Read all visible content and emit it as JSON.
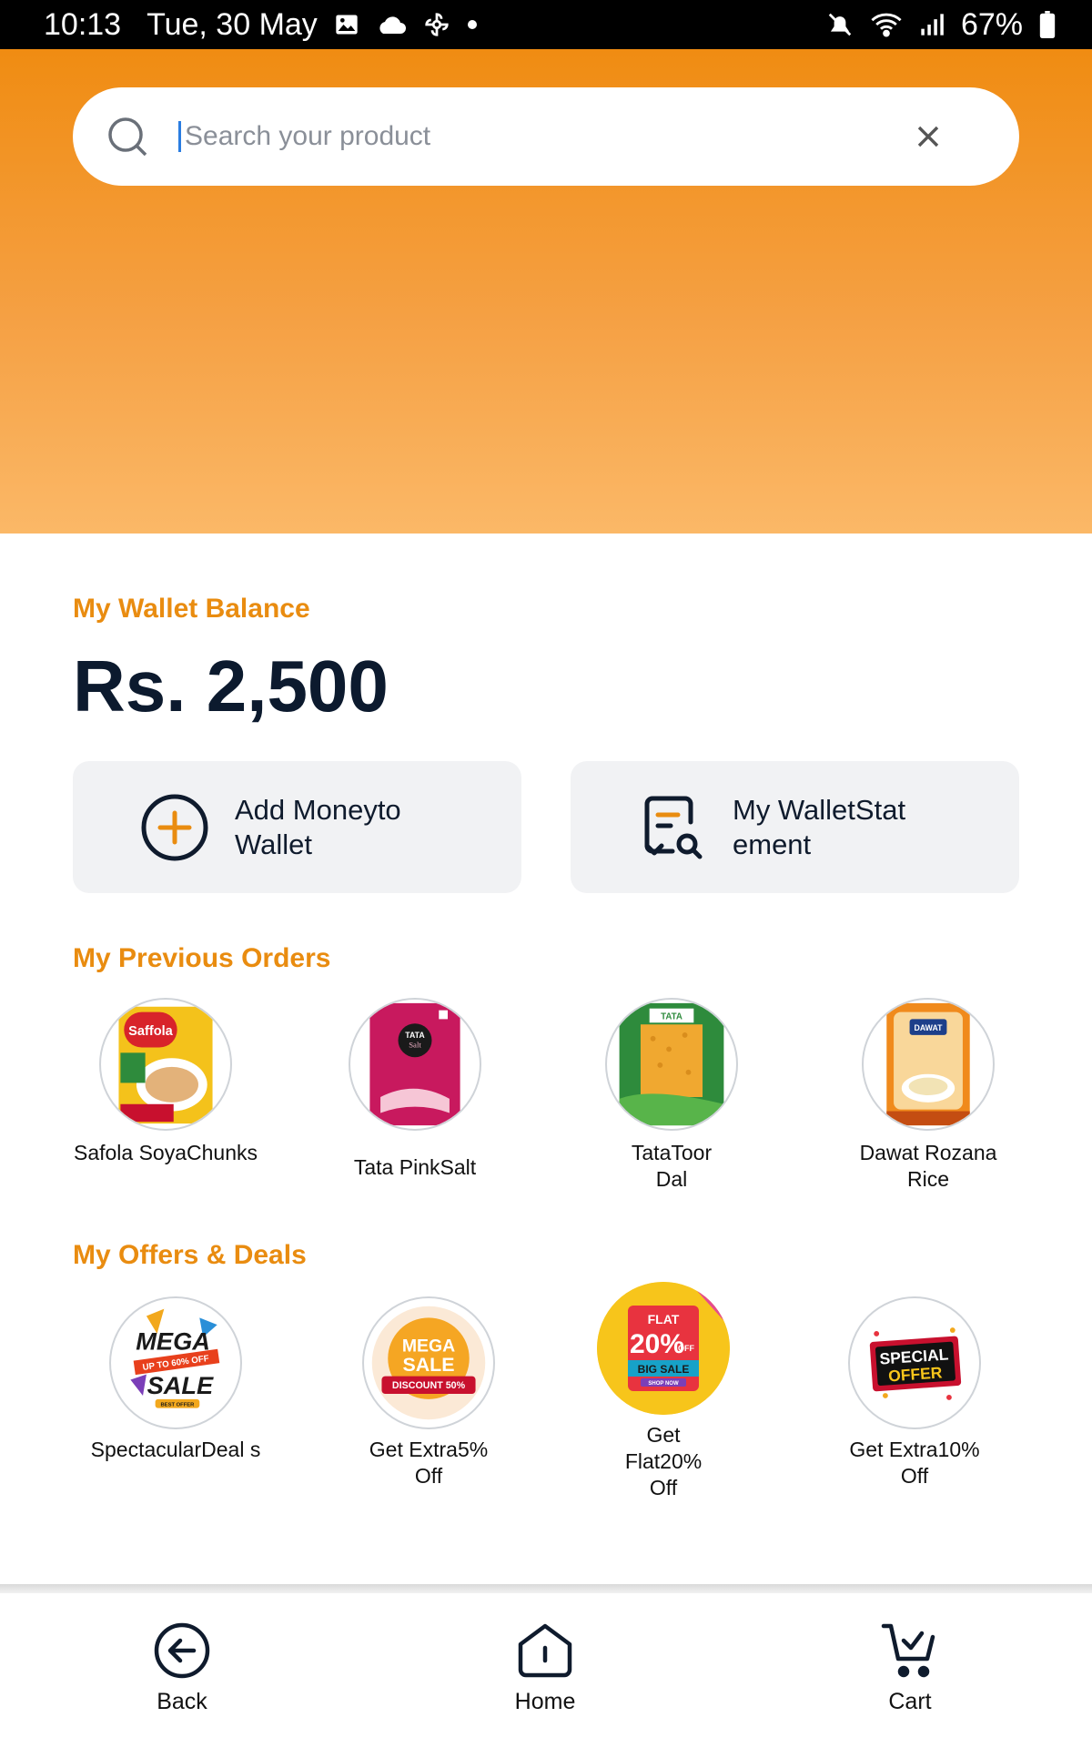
{
  "status_bar": {
    "time": "10:13",
    "date": "Tue, 30 May",
    "battery": "67%",
    "icons": [
      "image-icon",
      "cloud-icon",
      "pinwheel-icon",
      "dot-icon",
      "mute-icon",
      "wifi-icon",
      "signal-icon",
      "battery-icon"
    ]
  },
  "search": {
    "placeholder": "Search your product",
    "value": ""
  },
  "wallet": {
    "title": "My Wallet Balance",
    "balance": "Rs. 2,500",
    "add_money_label": "Add Moneyto Wallet",
    "statement_label": "My WalletStat ement"
  },
  "previous_orders": {
    "title": "My Previous Orders",
    "items": [
      {
        "name": "Safola SoyaChunks",
        "icon": "safola-soya-chunks-image"
      },
      {
        "name": "Tata PinkSalt",
        "icon": "tata-pink-salt-image"
      },
      {
        "name": "TataToor Dal",
        "icon": "tata-toor-dal-image"
      },
      {
        "name": "Dawat Rozana Rice",
        "icon": "dawat-rozana-rice-image"
      }
    ]
  },
  "offers": {
    "title": "My Offers & Deals",
    "items": [
      {
        "name": "SpectacularDeal s",
        "icon": "mega-sale-badge"
      },
      {
        "name": "Get Extra5% Off",
        "icon": "mega-sale-discount-badge"
      },
      {
        "name": "Get Flat20% Off",
        "icon": "flat-20-off-badge"
      },
      {
        "name": "Get Extra10% Off",
        "icon": "special-offer-badge"
      }
    ],
    "badge_text": {
      "mega": "MEGA",
      "upto": "UP TO 60% OFF",
      "sale": "SALE",
      "best_offer": "BEST OFFER",
      "mega2": "MEGA",
      "sale2": "SALE",
      "discount": "DISCOUNT 50%",
      "flat": "FLAT",
      "twenty": "20%",
      "off": "OFF",
      "big_sale": "BIG SALE",
      "shop_now": "SHOP NOW",
      "special": "SPECIAL",
      "offer": "OFFER"
    }
  },
  "bottom_nav": {
    "back": "Back",
    "home": "Home",
    "cart": "Cart"
  },
  "colors": {
    "accent": "#e98c10",
    "header_top": "#f08c12",
    "header_bottom": "#fbb867",
    "text_dark": "#0c1a2e",
    "button_bg": "#f1f2f4"
  }
}
